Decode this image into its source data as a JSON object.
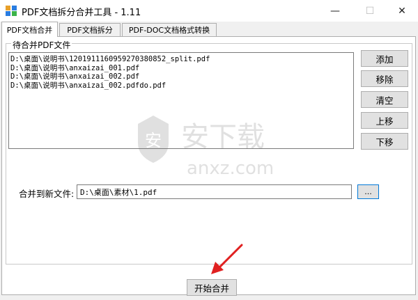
{
  "window": {
    "title": "PDF文档拆分合并工具 - 1.11",
    "minimize": "—",
    "maximize": "☐",
    "close": "✕"
  },
  "tabs": [
    {
      "label": "PDF文档合并",
      "active": true
    },
    {
      "label": "PDF文档拆分",
      "active": false
    },
    {
      "label": "PDF-DOC文档格式转换",
      "active": false
    }
  ],
  "group": {
    "title": "待合并PDF文件"
  },
  "files": [
    "D:\\桌面\\说明书\\1201911160959270380852_split.pdf",
    "D:\\桌面\\说明书\\anxaizai_001.pdf",
    "D:\\桌面\\说明书\\anxaizai_002.pdf",
    "D:\\桌面\\说明书\\anxaizai_002.pdfdo.pdf"
  ],
  "buttons": {
    "add": "添加",
    "remove": "移除",
    "clear": "清空",
    "up": "上移",
    "down": "下移",
    "browse": "...",
    "start": "开始合并"
  },
  "output": {
    "label": "合并到新文件:",
    "value": "D:\\桌面\\素材\\1.pdf"
  },
  "watermark": {
    "text": "anxz.com"
  },
  "colors": {
    "accent": "#0078d7",
    "arrow": "#e02020"
  }
}
